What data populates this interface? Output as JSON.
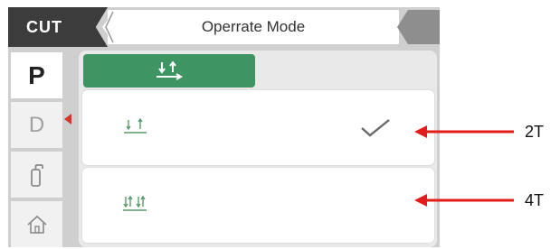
{
  "header": {
    "mode": "CUT",
    "title": "Operrate Mode"
  },
  "sidebar": {
    "items": [
      {
        "label": "P",
        "active": true
      },
      {
        "label": "D",
        "active": false
      },
      {
        "icon": "gas-cylinder-icon"
      },
      {
        "icon": "home-icon"
      }
    ]
  },
  "tab": {
    "icon": "trigger-2t-icon",
    "color": "#3f9463"
  },
  "options": [
    {
      "id": "2T",
      "icon": "trigger-2t-icon",
      "selected": true
    },
    {
      "id": "4T",
      "icon": "trigger-4t-icon",
      "selected": false
    }
  ],
  "annotations": {
    "label_2t": "2T",
    "label_4t": "4T",
    "arrow_color": "#e21b1b"
  }
}
